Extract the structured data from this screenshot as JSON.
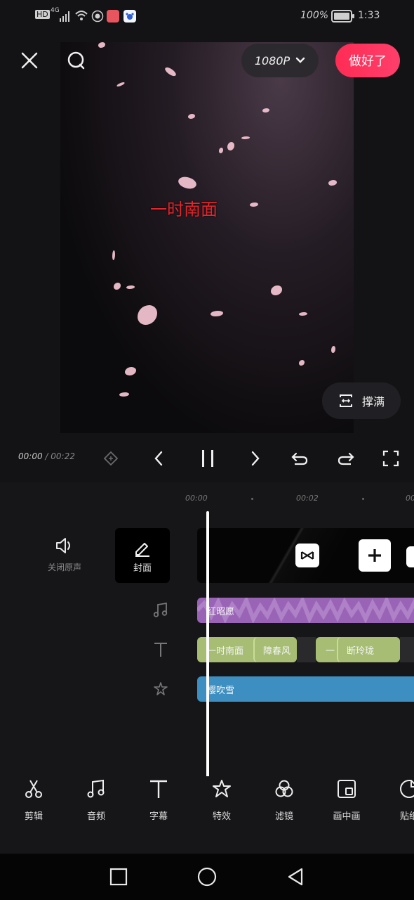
{
  "status_bar": {
    "hd_label": "HD",
    "network_label": "4G",
    "battery_text": "100%",
    "time": "1:33"
  },
  "toolbar": {
    "resolution": "1080P",
    "done_label": "做好了"
  },
  "preview": {
    "caption": "一时南面",
    "fill_label": "撑满"
  },
  "playback": {
    "current_time": "00:00",
    "separator": " / ",
    "total_time": "00:22"
  },
  "timeline": {
    "ruler": [
      "00:00",
      "00:02",
      "00"
    ],
    "mute_label": "关闭原声",
    "cover_label": "封面",
    "audio_clip": "红昭愿",
    "text_clips": [
      {
        "main": "一时南面",
        "inner": "障春风"
      },
      {
        "main": "一",
        "inner": "断玲珑"
      }
    ],
    "effect_clip": "樱吹雪"
  },
  "bottom_tools": [
    {
      "label": "剪辑",
      "icon": "scissors-icon"
    },
    {
      "label": "音频",
      "icon": "music-note-icon"
    },
    {
      "label": "字幕",
      "icon": "text-icon"
    },
    {
      "label": "特效",
      "icon": "star-sparkle-icon"
    },
    {
      "label": "滤镜",
      "icon": "filter-circles-icon"
    },
    {
      "label": "画中画",
      "icon": "picture-in-picture-icon"
    },
    {
      "label": "贴纸",
      "icon": "sticker-icon"
    }
  ],
  "colors": {
    "accent": "#fe2c55",
    "audio_track": "#9a64b6",
    "text_track": "#a6bd73",
    "effect_track": "#3d8fc2",
    "caption": "#e2262c"
  }
}
